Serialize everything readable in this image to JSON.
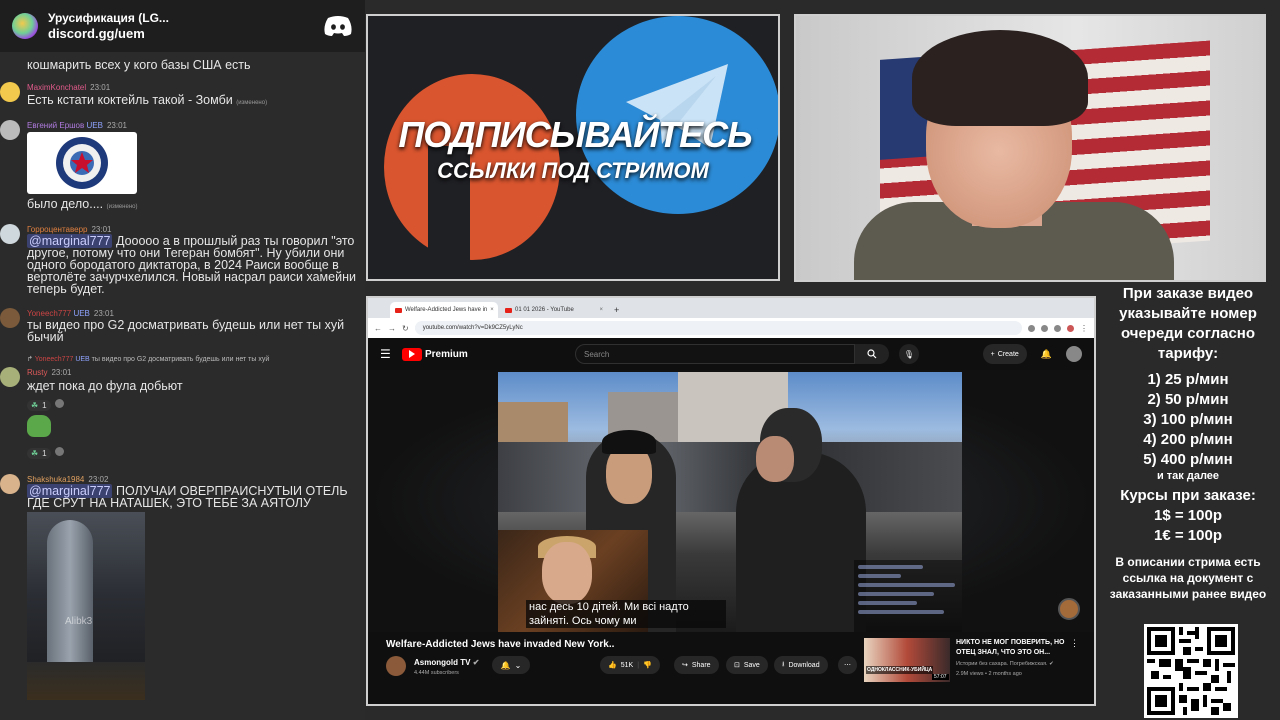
{
  "discord": {
    "server_name": "Урусификация (LG...",
    "invite": "discord.gg/uem",
    "clipped_line": "кошмарить всех у кого базы США есть",
    "messages": [
      {
        "user": "MaximKonchatel",
        "time": "23:01",
        "text": "Есть кстати коктейль такой - Зомби",
        "edited": "(изменено)"
      },
      {
        "user": "Евгений Ершов",
        "badge": "UEB",
        "time": "23:01",
        "text": "было дело....",
        "edited": "(изменено)"
      },
      {
        "user": "Горроцентаверр",
        "time": "23:01",
        "mention": "@marginal777",
        "text": " Дооооо а в прошлый раз ты говорил \"это другое, потому что они Тегеран бомбят\". Ну убили они одного бородатого диктатора, в 2024 Раиси вообще в вертолёте зачурчхелился. Новый насрал раиси хамейни теперь будет."
      },
      {
        "user": "Yoneech777",
        "badge": "UEB",
        "time": "23:01",
        "text": "ты видео про G2 досматривать будешь или нет ты хуй бычий"
      },
      {
        "reply_user": "Yoneech777",
        "reply_badge": "UEB",
        "reply_text": "ты видео про G2 досматривать будешь или нет ты хуй",
        "user": "Rusty",
        "time": "23:01",
        "text": "ждет пока до фула добьют",
        "react1": "1",
        "react2": "1"
      },
      {
        "user": "Shakshuka1984",
        "time": "23:02",
        "mention": "@marginal777",
        "text": " ПОЛУЧАИ ОВЕРПРАИСНУТЫИ ОТЕЛЬ ГДЕ СРУТ НА НАТАШЕК, ЭТО ТЕБЕ  ЗА АЯТОЛУ",
        "watermark": "Alibk3"
      }
    ]
  },
  "subcard": {
    "big": "ПОДПИСЫВАЙТЕСЬ",
    "small": "ССЫЛКИ ПОД СТРИМОМ"
  },
  "prices": {
    "intro": "При заказе видео указывайте номер очереди согласно тарифу:",
    "tiers": [
      "1) 25 р/мин",
      "2) 50 р/мин",
      "3) 100 р/мин",
      "4) 200 р/мин",
      "5) 400 р/мин"
    ],
    "more": "и так далее",
    "rates_heading": "Курсы при заказе:",
    "rates": [
      "1$ = 100р",
      "1€ = 100р"
    ],
    "note": "В описании стрима есть ссылка на документ с заказанными ранее видео"
  },
  "browser": {
    "tabs": [
      {
        "label": "Welfare-Addicted Jews have in",
        "close": "×"
      },
      {
        "label": "01 01 2026 - YouTube",
        "close": "×"
      }
    ],
    "new_tab": "+",
    "url": "youtube.com/watch?v=Dk9CZ5yLyNc"
  },
  "youtube": {
    "brand": "Premium",
    "search_placeholder": "Search",
    "create": "Create",
    "subtitle": "нас десь 10 дітей.  Ми всі надто зайняті.  Ось чому ми",
    "title": "Welfare-Addicted Jews have invaded New York..",
    "channel": "Asmongold TV",
    "subscribers": "4.44M subscribers",
    "likes": "51K",
    "share": "Share",
    "save": "Save",
    "download": "Download",
    "related": {
      "title": "НИКТО НЕ МОГ ПОВЕРИТЬ, НО ОТЕЦ ЗНАЛ, ЧТО ЭТО ОН...",
      "channel": "Истории без сахара. Погребижская.",
      "meta": "2.9M views • 2 months ago",
      "thumb_text": "ОДНОКЛАССНИК-УБИЙЦА",
      "duration": "57:07"
    }
  }
}
